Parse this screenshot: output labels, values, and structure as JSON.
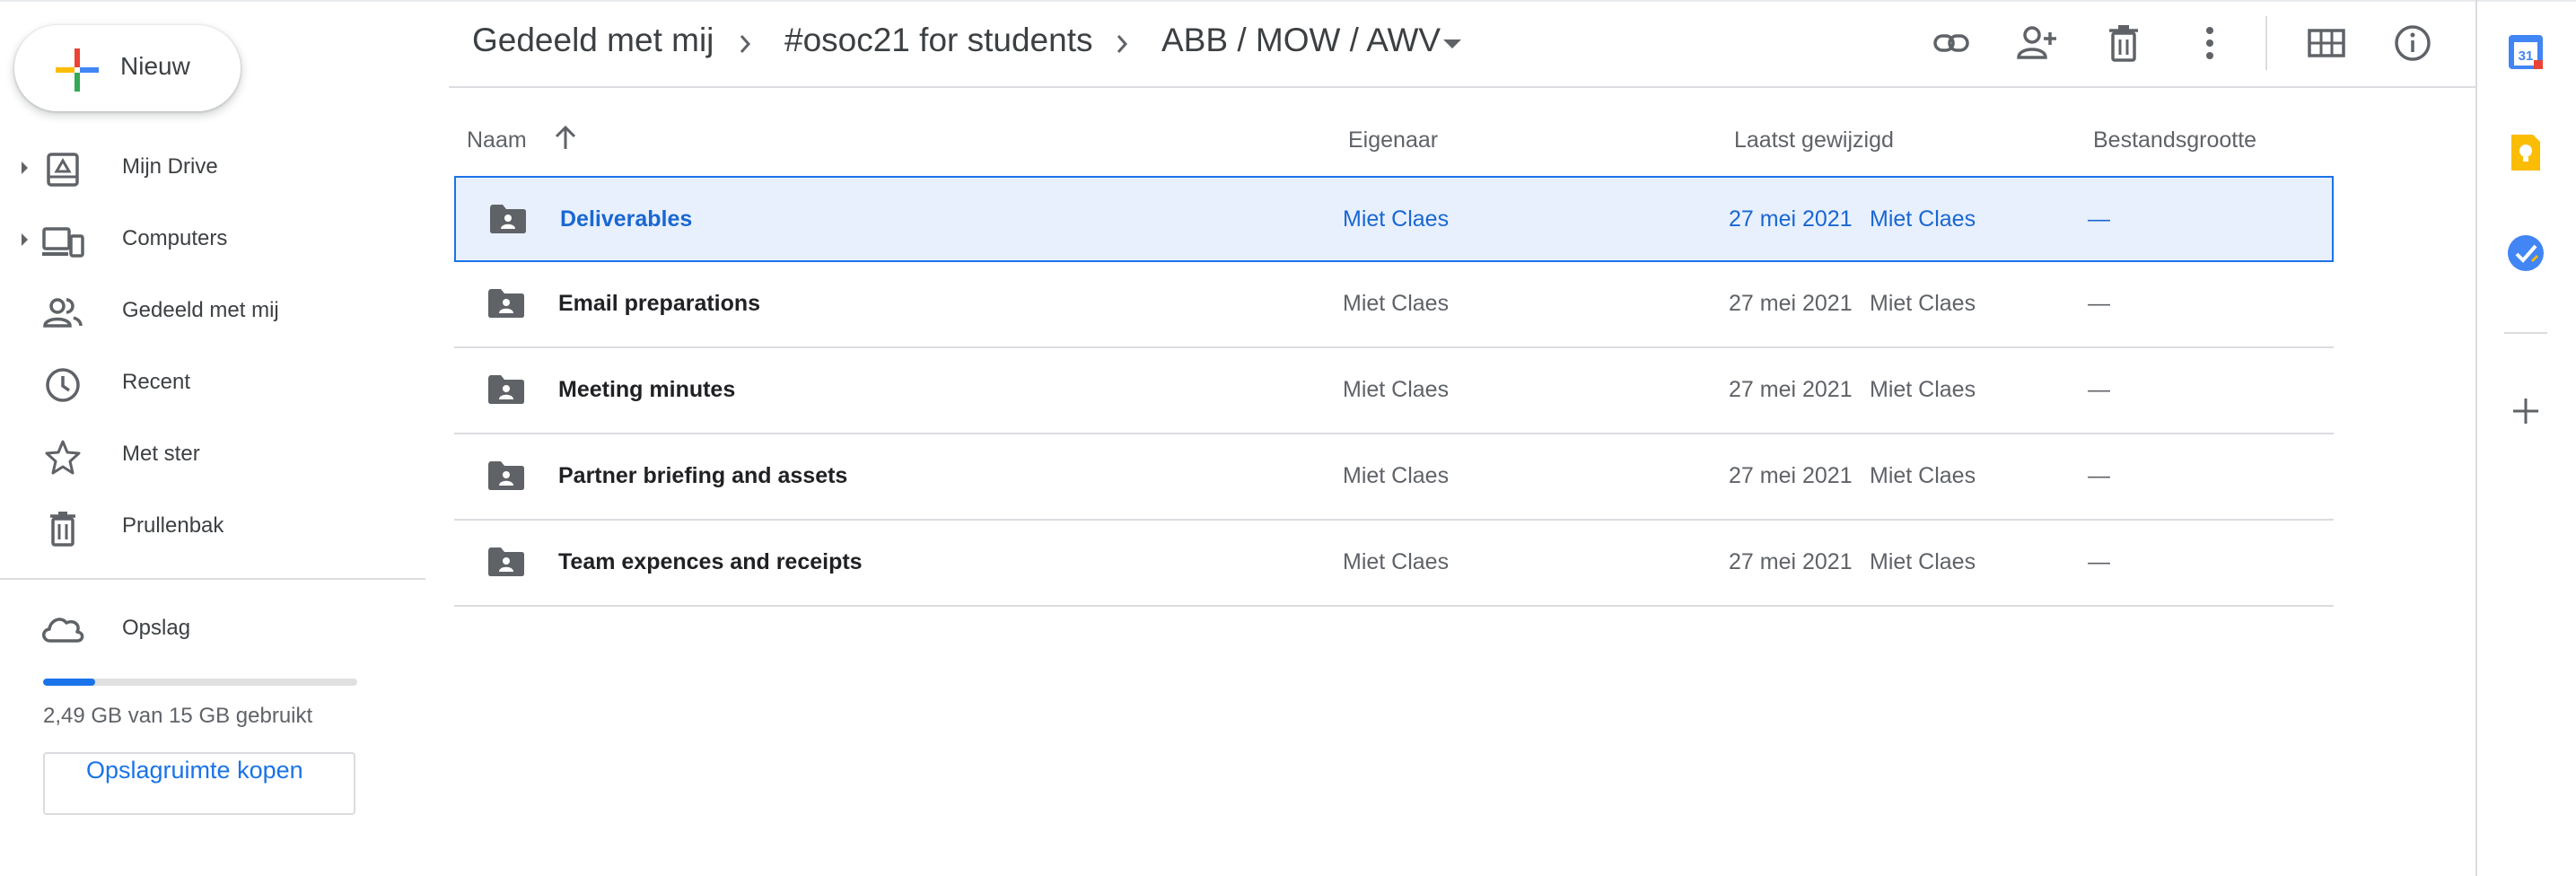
{
  "new_button": {
    "label": "Nieuw"
  },
  "sidebar": {
    "items": [
      {
        "label": "Mijn Drive",
        "icon": "my-drive-icon",
        "expandable": true
      },
      {
        "label": "Computers",
        "icon": "computers-icon",
        "expandable": true
      },
      {
        "label": "Gedeeld met mij",
        "icon": "shared-people-icon",
        "expandable": false
      },
      {
        "label": "Recent",
        "icon": "clock-icon",
        "expandable": false
      },
      {
        "label": "Met ster",
        "icon": "star-icon",
        "expandable": false
      },
      {
        "label": "Prullenbak",
        "icon": "trash-icon",
        "expandable": false
      }
    ],
    "storage": {
      "label": "Opslag",
      "usage_text": "2,49 GB van 15 GB gebruikt",
      "used_fraction": 0.166,
      "buy_button": "Opslagruimte kopen"
    }
  },
  "breadcrumb": {
    "items": [
      "Gedeeld met mij",
      "#osoc21 for students",
      "ABB / MOW / AWV"
    ],
    "separator_icon": "chevron-right-icon",
    "dropdown_icon": "caret-down-icon"
  },
  "toolbar": {
    "actions": [
      "link-icon",
      "add-person-icon",
      "trash-icon",
      "more-vert-icon",
      "grid-view-icon",
      "info-icon"
    ]
  },
  "table": {
    "columns": {
      "name": "Naam",
      "owner": "Eigenaar",
      "modified": "Laatst gewijzigd",
      "size": "Bestandsgrootte"
    },
    "sort": {
      "column": "name",
      "direction": "ascending"
    },
    "rows": [
      {
        "name": "Deliverables",
        "owner": "Miet Claes",
        "modified_date": "27 mei 2021",
        "modified_by": "Miet Claes",
        "size": "—",
        "selected": true
      },
      {
        "name": "Email preparations",
        "owner": "Miet Claes",
        "modified_date": "27 mei 2021",
        "modified_by": "Miet Claes",
        "size": "—",
        "selected": false
      },
      {
        "name": "Meeting minutes",
        "owner": "Miet Claes",
        "modified_date": "27 mei 2021",
        "modified_by": "Miet Claes",
        "size": "—",
        "selected": false
      },
      {
        "name": "Partner briefing and assets",
        "owner": "Miet Claes",
        "modified_date": "27 mei 2021",
        "modified_by": "Miet Claes",
        "size": "—",
        "selected": false
      },
      {
        "name": "Team expences and receipts",
        "owner": "Miet Claes",
        "modified_date": "27 mei 2021",
        "modified_by": "Miet Claes",
        "size": "—",
        "selected": false
      }
    ]
  },
  "side_panel": {
    "calendar_day": "31",
    "apps": [
      "calendar-icon",
      "keep-icon",
      "tasks-icon",
      "add-addon-icon"
    ]
  },
  "colors": {
    "accent": "#1a73e8",
    "selected_bg": "#e8f0fe",
    "keep": "#fbbc04",
    "tasks": "#4285f4"
  }
}
